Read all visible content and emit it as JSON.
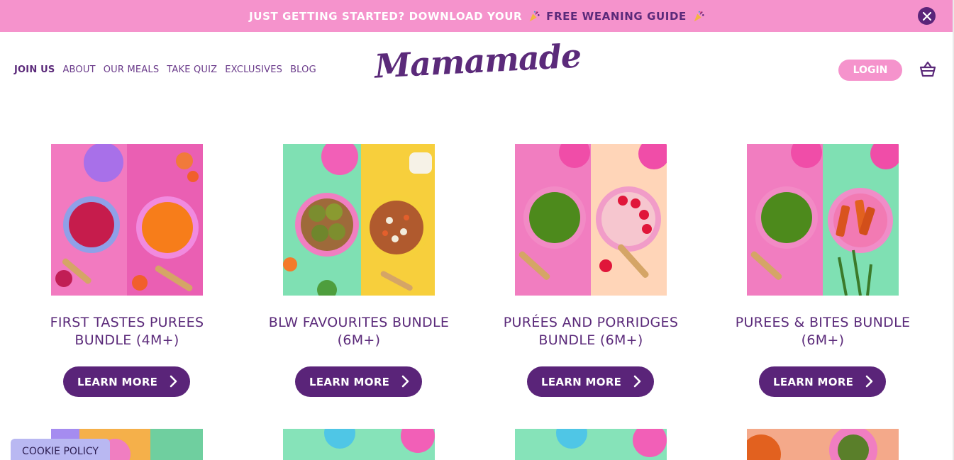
{
  "announcement": {
    "text_before": "JUST GETTING STARTED? DOWNLOAD YOUR",
    "link_text": "FREE WEANING GUIDE",
    "colors": {
      "bg": "#f593cc",
      "text": "#ffffff",
      "link": "#5b2a7a"
    }
  },
  "header": {
    "nav": [
      "JOIN US",
      "ABOUT",
      "OUR MEALS",
      "TAKE QUIZ",
      "EXCLUSIVES",
      "BLOG"
    ],
    "logo": "Mamamade",
    "login_label": "LOGIN"
  },
  "icons": {
    "close": "close-icon",
    "cart": "basket-icon",
    "chevron": "chevron-right-icon",
    "party": "party-popper-icon"
  },
  "products": [
    {
      "title": "FIRST TASTES PUREES BUNDLE (4M+)",
      "button": "LEARN MORE"
    },
    {
      "title": "BLW FAVOURITES BUNDLE (6M+)",
      "button": "LEARN MORE"
    },
    {
      "title": "PURÉES AND PORRIDGES BUNDLE (6M+)",
      "button": "LEARN MORE"
    },
    {
      "title": "PUREES & BITES BUNDLE (6M+)",
      "button": "LEARN MORE"
    }
  ],
  "cookie_label": "COOKIE POLICY",
  "colors": {
    "brand_purple": "#5a2479",
    "brand_pink": "#f593cc",
    "cookie_bg": "#b9b8f2"
  }
}
